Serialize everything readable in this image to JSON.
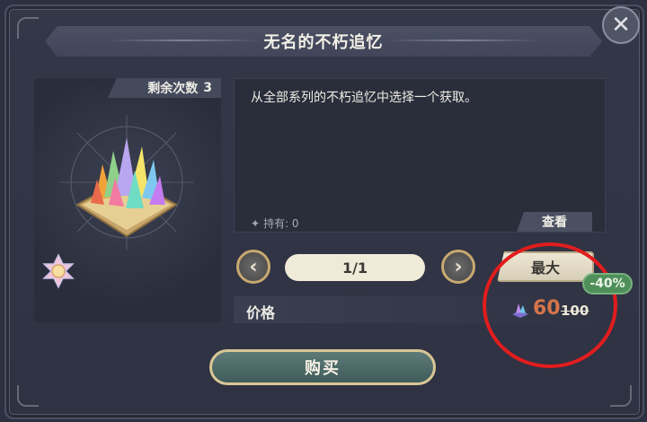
{
  "title": "无名的不朽追忆",
  "close_icon": "close-icon",
  "remaining": {
    "label": "剩余次数",
    "value": "3"
  },
  "description": "从全部系列的不朽追忆中选择一个获取。",
  "owned": {
    "icon": "sparkle-icon",
    "label": "持有: 0"
  },
  "view_button": "查看",
  "quantity": {
    "value": "1/1",
    "prev_icon": "chevron-left-icon",
    "next_icon": "chevron-right-icon"
  },
  "max_button": "最大",
  "discount": "-40%",
  "price": {
    "label": "价格",
    "current": "60",
    "original": "100",
    "currency_icon": "crystal-currency-icon"
  },
  "buy_button": "购买",
  "colors": {
    "accent_gold": "#c8a970",
    "price_orange": "#d5754a",
    "discount_green": "#4f8f5a",
    "highlight_red": "#e11d1d"
  }
}
